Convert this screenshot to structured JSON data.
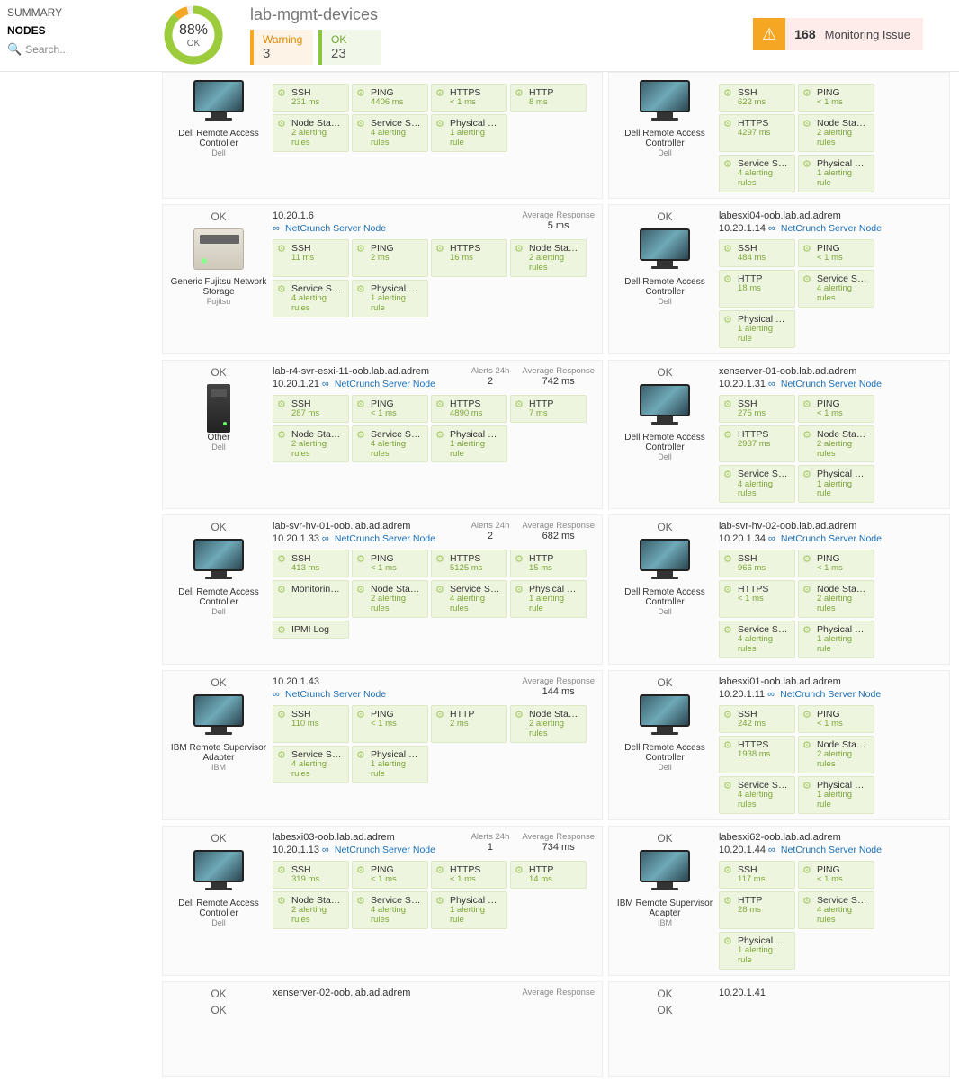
{
  "sidebar": {
    "summary": "SUMMARY",
    "nodes": "NODES",
    "search_placeholder": "Search..."
  },
  "header": {
    "donut": {
      "percent": "88%",
      "label": "OK",
      "green": 88,
      "orange": 8
    },
    "title": "lab-mgmt-devices",
    "warn": {
      "label": "Warning",
      "count": "3"
    },
    "ok": {
      "label": "OK",
      "count": "23"
    },
    "alert": {
      "count": "168",
      "text": "Monitoring Issue"
    }
  },
  "srvlink_label": "NetCrunch Server Node",
  "devices": {
    "drac": {
      "name": "Dell Remote Access Controller",
      "sub": "Dell"
    },
    "fuj": {
      "name": "Generic Fujitsu Network Storage",
      "sub": "Fujitsu"
    },
    "other": {
      "name": "Other",
      "sub": "Dell"
    },
    "ibm": {
      "name": "IBM Remote Supervisor Adapter",
      "sub": "IBM"
    }
  },
  "labels": {
    "ok": "OK",
    "alerts24": "Alerts 24h",
    "avgresp": "Average Response"
  },
  "cards": [
    {
      "id": "a1",
      "dev": "drac",
      "img": "monitor",
      "partial": true,
      "metrics": [
        [
          "SSH",
          "231 ms"
        ],
        [
          "PING",
          "4406 ms"
        ],
        [
          "HTTPS",
          "< 1 ms"
        ],
        [
          "HTTP",
          "8 ms"
        ],
        [
          "Node Status",
          "2 alerting rules"
        ],
        [
          "Service Status",
          "4 alerting rules"
        ],
        [
          "Physical Segm...",
          "1 alerting rule"
        ]
      ]
    },
    {
      "id": "a2",
      "dev": "drac",
      "img": "monitor",
      "partial": true,
      "metrics": [
        [
          "SSH",
          "622 ms"
        ],
        [
          "PING",
          "< 1 ms"
        ],
        [
          "HTTPS",
          "4297 ms"
        ],
        [
          "Node Status",
          "2 alerting rules"
        ],
        [
          "Service Status",
          "4 alerting rules"
        ],
        [
          "Physical Segm...",
          "1 alerting rule"
        ]
      ]
    },
    {
      "id": "b1",
      "dev": "fuj",
      "img": "nas",
      "host": "10.20.1.6",
      "link": true,
      "avg": "5 ms",
      "metrics": [
        [
          "SSH",
          "11 ms"
        ],
        [
          "PING",
          "2 ms"
        ],
        [
          "HTTPS",
          "16 ms"
        ],
        [
          "Node Status",
          "2 alerting rules"
        ],
        [
          "Service Status",
          "4 alerting rules"
        ],
        [
          "Physical Segm...",
          "1 alerting rule"
        ]
      ]
    },
    {
      "id": "b2",
      "dev": "drac",
      "img": "monitor",
      "host": "labesxi04-oob.lab.ad.adrem",
      "ip": "10.20.1.14",
      "link": true,
      "metrics": [
        [
          "SSH",
          "484 ms"
        ],
        [
          "PING",
          "< 1 ms"
        ],
        [
          "HTTP",
          "18 ms"
        ],
        [
          "Service Status",
          "4 alerting rules"
        ],
        [
          "Physical Segm...",
          "1 alerting rule"
        ]
      ]
    },
    {
      "id": "c1",
      "dev": "other",
      "img": "tower",
      "host": "lab-r4-svr-esxi-11-oob.lab.ad.adrem",
      "ip": "10.20.1.21",
      "link": true,
      "alerts": "2",
      "avg": "742 ms",
      "metrics": [
        [
          "SSH",
          "287 ms"
        ],
        [
          "PING",
          "< 1 ms"
        ],
        [
          "HTTPS",
          "4890 ms"
        ],
        [
          "HTTP",
          "7 ms"
        ],
        [
          "Node Status",
          "2 alerting rules"
        ],
        [
          "Service Status",
          "4 alerting rules"
        ],
        [
          "Physical Segm...",
          "1 alerting rule"
        ]
      ]
    },
    {
      "id": "c2",
      "dev": "drac",
      "img": "monitor",
      "host": "xenserver-01-oob.lab.ad.adrem",
      "ip": "10.20.1.31",
      "link": true,
      "metrics": [
        [
          "SSH",
          "275 ms"
        ],
        [
          "PING",
          "< 1 ms"
        ],
        [
          "HTTPS",
          "2937 ms"
        ],
        [
          "Node Status",
          "2 alerting rules"
        ],
        [
          "Service Status",
          "4 alerting rules"
        ],
        [
          "Physical Segm...",
          "1 alerting rule"
        ]
      ]
    },
    {
      "id": "d1",
      "dev": "drac",
      "img": "monitor",
      "host": "lab-svr-hv-01-oob.lab.ad.adrem",
      "ip": "10.20.1.33",
      "link": true,
      "alerts": "2",
      "avg": "682 ms",
      "metrics": [
        [
          "SSH",
          "413 ms"
        ],
        [
          "PING",
          "< 1 ms"
        ],
        [
          "HTTPS",
          "5125 ms"
        ],
        [
          "HTTP",
          "15 ms"
        ],
        [
          "Monitoring Sen...",
          ""
        ],
        [
          "Node Status",
          "2 alerting rules"
        ],
        [
          "Service Status",
          "4 alerting rules"
        ],
        [
          "Physical Segm...",
          "1 alerting rule"
        ],
        [
          "IPMI Log",
          ""
        ]
      ]
    },
    {
      "id": "d2",
      "dev": "drac",
      "img": "monitor",
      "host": "lab-svr-hv-02-oob.lab.ad.adrem",
      "ip": "10.20.1.34",
      "link": true,
      "metrics": [
        [
          "SSH",
          "966 ms"
        ],
        [
          "PING",
          "< 1 ms"
        ],
        [
          "HTTPS",
          "< 1 ms"
        ],
        [
          "Node Status",
          "2 alerting rules"
        ],
        [
          "Service Status",
          "4 alerting rules"
        ],
        [
          "Physical Segm...",
          "1 alerting rule"
        ]
      ]
    },
    {
      "id": "e1",
      "dev": "ibm",
      "img": "monitor",
      "host": "10.20.1.43",
      "link": true,
      "avg": "144 ms",
      "metrics": [
        [
          "SSH",
          "110 ms"
        ],
        [
          "PING",
          "< 1 ms"
        ],
        [
          "HTTP",
          "2 ms"
        ],
        [
          "Node Status",
          "2 alerting rules"
        ],
        [
          "Service Status",
          "4 alerting rules"
        ],
        [
          "Physical Segm...",
          "1 alerting rule"
        ]
      ]
    },
    {
      "id": "e2",
      "dev": "drac",
      "img": "monitor",
      "host": "labesxi01-oob.lab.ad.adrem",
      "ip": "10.20.1.11",
      "link": true,
      "metrics": [
        [
          "SSH",
          "242 ms"
        ],
        [
          "PING",
          "< 1 ms"
        ],
        [
          "HTTPS",
          "1938 ms"
        ],
        [
          "Node Status",
          "2 alerting rules"
        ],
        [
          "Service Status",
          "4 alerting rules"
        ],
        [
          "Physical Segm...",
          "1 alerting rule"
        ]
      ]
    },
    {
      "id": "f1",
      "dev": "drac",
      "img": "monitor",
      "host": "labesxi03-oob.lab.ad.adrem",
      "ip": "10.20.1.13",
      "link": true,
      "alerts": "1",
      "avg": "734 ms",
      "metrics": [
        [
          "SSH",
          "319 ms"
        ],
        [
          "PING",
          "< 1 ms"
        ],
        [
          "HTTPS",
          "< 1 ms"
        ],
        [
          "HTTP",
          "14 ms"
        ],
        [
          "Node Status",
          "2 alerting rules"
        ],
        [
          "Service Status",
          "4 alerting rules"
        ],
        [
          "Physical Segm...",
          "1 alerting rule"
        ]
      ]
    },
    {
      "id": "f2",
      "dev": "ibm",
      "img": "monitor",
      "host": "labesxi62-oob.lab.ad.adrem",
      "ip": "10.20.1.44",
      "link": true,
      "metrics": [
        [
          "SSH",
          "117 ms"
        ],
        [
          "PING",
          "< 1 ms"
        ],
        [
          "HTTP",
          "28 ms"
        ],
        [
          "Service Status",
          "4 alerting rules"
        ],
        [
          "Physical Segm...",
          "1 alerting rule"
        ]
      ]
    },
    {
      "id": "g1",
      "dev": "drac",
      "img": "none",
      "host": "xenserver-02-oob.lab.ad.adrem",
      "partial_bottom": true,
      "avg": ""
    },
    {
      "id": "g2",
      "dev": "drac",
      "img": "none",
      "host": "10.20.1.41",
      "partial_bottom": true
    }
  ]
}
